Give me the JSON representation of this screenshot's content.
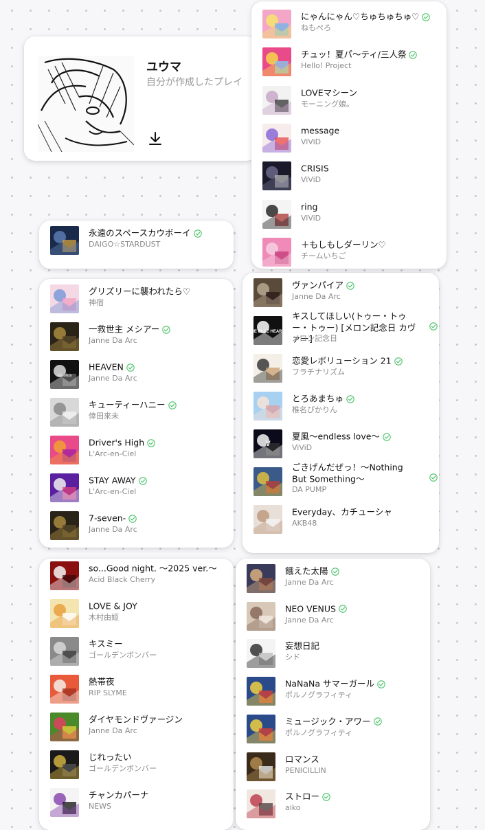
{
  "profile": {
    "name": "ユウマ",
    "subtitle": "自分が作成したプレイ"
  },
  "accent": {
    "check": "#4cc46a"
  },
  "cards": {
    "top": [
      {
        "title": "にゃんにゃん♡ちゅちゅちゅ♡",
        "artist": "ねもぺろ",
        "checked": true,
        "art": [
          "#f3a6c8",
          "#f7e36b",
          "#6fb6e8"
        ]
      },
      {
        "title": "チュッ！夏パ〜ティ/三人祭",
        "artist": "Hello! Project",
        "checked": true,
        "art": [
          "#e94a8a",
          "#f7d44a",
          "#7fd0f0"
        ]
      },
      {
        "title": "LOVEマシーン",
        "artist": "モーニング娘。",
        "checked": false,
        "art": [
          "#f2f2f2",
          "#c9a9c9",
          "#333"
        ]
      },
      {
        "title": "message",
        "artist": "ViViD",
        "checked": false,
        "art": [
          "#f7ecec",
          "#8a6ad8",
          "#e84a4a"
        ]
      },
      {
        "title": "CRISIS",
        "artist": "ViViD",
        "checked": false,
        "art": [
          "#1a1a2a",
          "#6a6a8a",
          "#bbb"
        ]
      },
      {
        "title": "ring",
        "artist": "ViViD",
        "checked": false,
        "art": [
          "#f4f4f4",
          "#2a2a2a",
          "#a33"
        ]
      },
      {
        "title": "＋もしもしダーリン♡",
        "artist": "チームいちご",
        "checked": false,
        "art": [
          "#f08ab8",
          "#f6d0e0",
          "#c33a7a"
        ]
      }
    ],
    "single": [
      {
        "title": "永遠のスペースカウボーイ",
        "artist": "DAIGO☆STARDUST",
        "checked": true,
        "art": [
          "#1a2a4a",
          "#5a7ab0",
          "#d0a040"
        ]
      }
    ],
    "left1": [
      {
        "title": "グリズリーに襲われたら♡",
        "artist": "神宿",
        "checked": false,
        "art": [
          "#f4d8e4",
          "#7a9ad8",
          "#f0a0c0"
        ]
      },
      {
        "title": "一救世主 メシアー",
        "artist": "Janne Da Arc",
        "checked": true,
        "art": [
          "#2a2418",
          "#a88a40",
          "#5a4a2a"
        ]
      },
      {
        "title": "HEAVEN",
        "artist": "Janne Da Arc",
        "checked": true,
        "art": [
          "#111",
          "#ddd",
          "#666"
        ],
        "label": "Möbius"
      },
      {
        "title": "キューティーハニー",
        "artist": "倖田來未",
        "checked": true,
        "art": [
          "#d8d8d8",
          "#8a8a8a",
          "#f4f4f4"
        ]
      },
      {
        "title": "Driver's High",
        "artist": "L'Arc-en-Ciel",
        "checked": true,
        "art": [
          "#e84a8a",
          "#f0a030",
          "#a020a0"
        ]
      },
      {
        "title": "STAY AWAY",
        "artist": "L'Arc-en-Ciel",
        "checked": true,
        "art": [
          "#5a20a0",
          "#f0f0f0",
          "#e04080"
        ]
      },
      {
        "title": "7-seven-",
        "artist": "Janne Da Arc",
        "checked": true,
        "art": [
          "#2a2418",
          "#a88a40",
          "#5a4a2a"
        ]
      }
    ],
    "right1": [
      {
        "title": "ヴァンパイア",
        "artist": "Janne Da Arc",
        "checked": true,
        "art": [
          "#5a4a3a",
          "#b8a890",
          "#2a1a1a"
        ]
      },
      {
        "title": "キスしてほしい(トゥー・トゥー・トゥー) [メロン記念日 カヴァー]",
        "artist": "メロン記念日",
        "checked": true,
        "art": [
          "#111",
          "#fff",
          "#111"
        ],
        "label": "THE BLUE HEARTS",
        "wrap": true
      },
      {
        "title": "恋愛レボリューション 21",
        "artist": "フラチナリズム",
        "checked": true,
        "art": [
          "#f4f0e8",
          "#3a3a3a",
          "#c8a070"
        ]
      },
      {
        "title": "とろあまちゅ",
        "artist": "椎名ぴかりん",
        "checked": true,
        "art": [
          "#a8d0f0",
          "#f4e4d8",
          "#e0a0a0"
        ]
      },
      {
        "title": "夏風〜endless love〜",
        "artist": "ViViD",
        "checked": true,
        "art": [
          "#0a0a1a",
          "#f4f4f4",
          "#333"
        ],
        "label": "V"
      },
      {
        "title": "ごきげんだぜっ！〜Nothing But Something〜",
        "artist": "DA PUMP",
        "checked": true,
        "art": [
          "#3a5a8a",
          "#e0c040",
          "#c04030"
        ],
        "wrap": true
      },
      {
        "title": "Everyday、カチューシャ",
        "artist": "AKB48",
        "checked": false,
        "art": [
          "#e8e0d8",
          "#c09a80",
          "#f4f4f4"
        ]
      }
    ],
    "left2": [
      {
        "title": "so...Good night. 〜2025 ver.〜",
        "artist": "Acid Black Cherry",
        "checked": false,
        "art": [
          "#8a1010",
          "#f4f4f4",
          "#3a0a0a"
        ]
      },
      {
        "title": "LOVE & JOY",
        "artist": "木村由姫",
        "checked": false,
        "art": [
          "#f4e4b0",
          "#e8a040",
          "#fff"
        ]
      },
      {
        "title": "キスミー",
        "artist": "ゴールデンボンバー",
        "checked": false,
        "art": [
          "#8a8a8a",
          "#d8d8d8",
          "#3a3a3a"
        ]
      },
      {
        "title": "熱帯夜",
        "artist": "RIP SLYME",
        "checked": false,
        "art": [
          "#e85a3a",
          "#f4f0e8",
          "#a03020"
        ]
      },
      {
        "title": "ダイヤモンドヴァージン",
        "artist": "Janne Da Arc",
        "checked": false,
        "art": [
          "#4a8a2a",
          "#e04060",
          "#f0d040"
        ]
      },
      {
        "title": "じれったい",
        "artist": "ゴールデンボンバー",
        "checked": false,
        "art": [
          "#1a1a1a",
          "#d0b040",
          "#555"
        ]
      },
      {
        "title": "チャンカパーナ",
        "artist": "NEWS",
        "checked": false,
        "art": [
          "#f4f4f4",
          "#8a4ab0",
          "#111"
        ]
      }
    ],
    "right2": [
      {
        "title": "餓えた太陽",
        "artist": "Janne Da Arc",
        "checked": true,
        "art": [
          "#3a3a5a",
          "#d8b080",
          "#8a4a3a"
        ]
      },
      {
        "title": "NEO VENUS",
        "artist": "Janne Da Arc",
        "checked": true,
        "art": [
          "#d8c8b8",
          "#8a6a5a",
          "#f4ece4"
        ]
      },
      {
        "title": "妄想日記",
        "artist": "シド",
        "checked": false,
        "art": [
          "#f4f4f4",
          "#333",
          "#bbb"
        ]
      },
      {
        "title": "NaNaNa サマーガール",
        "artist": "ポルノグラフィティ",
        "checked": true,
        "art": [
          "#2a4a8a",
          "#f0d040",
          "#e04030"
        ]
      },
      {
        "title": "ミュージック・アワー",
        "artist": "ポルノグラフィティ",
        "checked": true,
        "art": [
          "#2a4a8a",
          "#f0d040",
          "#e04030"
        ]
      },
      {
        "title": "ロマンス",
        "artist": "PENICILLIN",
        "checked": false,
        "art": [
          "#3a2a1a",
          "#b08a50",
          "#f4f4f4"
        ]
      },
      {
        "title": "ストロー",
        "artist": "aiko",
        "checked": true,
        "art": [
          "#f0e8e0",
          "#c04050",
          "#4a3a3a"
        ]
      }
    ]
  }
}
